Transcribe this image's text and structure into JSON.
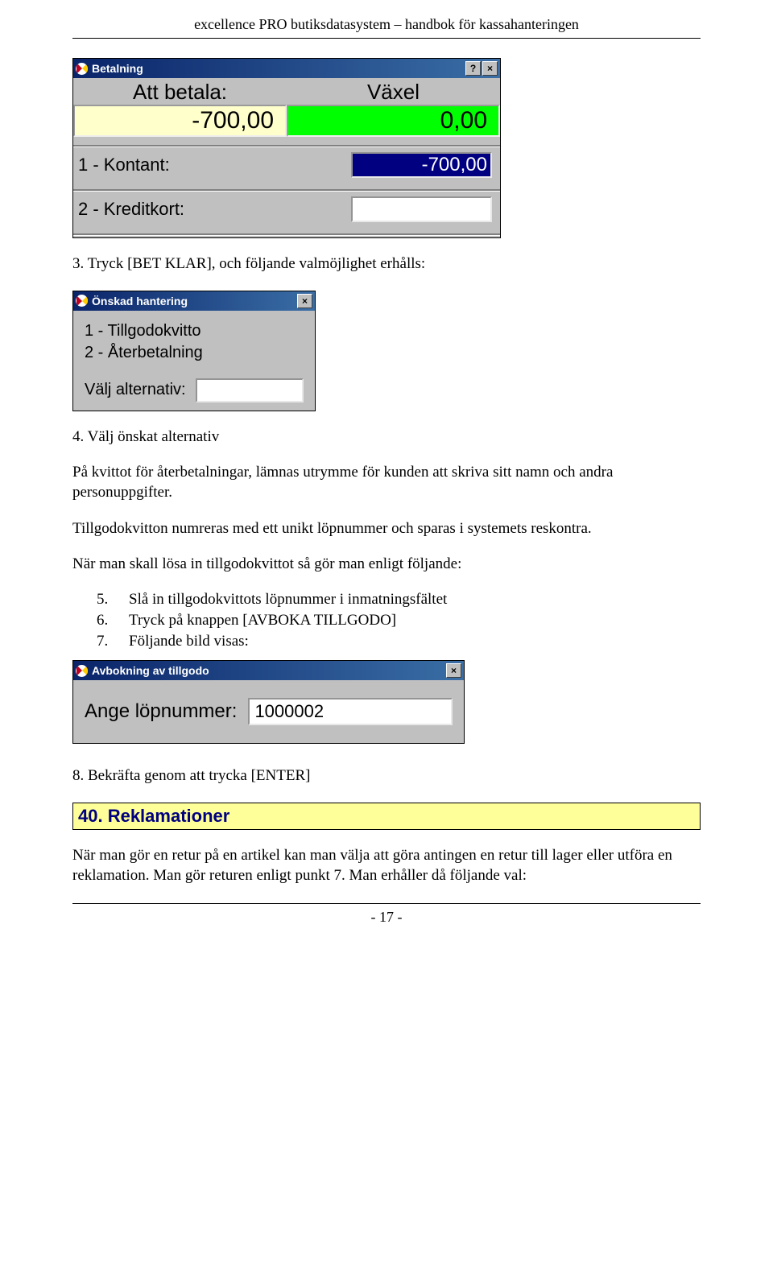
{
  "header": "excellence PRO butiksdatasystem – handbok för kassahanteringen",
  "footer": "- 17 -",
  "betalning": {
    "title": "Betalning",
    "att_betala_label": "Att betala:",
    "att_betala_value": "-700,00",
    "vaxel_label": "Växel",
    "vaxel_value": "0,00",
    "row1_label": "1 - Kontant:",
    "row1_value": "-700,00",
    "row2_label": "2 - Kreditkort:",
    "row2_value": ""
  },
  "step3": "3.   Tryck [BET KLAR], och följande valmöjlighet erhålls:",
  "onskad": {
    "title": "Önskad hantering",
    "opt1": "1 - Tillgodokvitto",
    "opt2": "2 - Återbetalning",
    "prompt": "Välj alternativ:"
  },
  "step4": "4.   Välj önskat alternativ",
  "para1": "På kvittot för återbetalningar, lämnas utrymme för kunden att skriva sitt namn och andra personuppgifter.",
  "para2": "Tillgodokvitton numreras med ett unikt löpnummer och sparas i systemets reskontra.",
  "para3": "När man skall lösa in tillgodokvittot så gör man enligt följande:",
  "list": {
    "i5": "Slå in tillgodokvittots löpnummer i inmatningsfältet",
    "i6": "Tryck på knappen [AVBOKA TILLGODO]",
    "i7": "Följande bild visas:"
  },
  "avbok": {
    "title": "Avbokning av  tillgodo",
    "label": "Ange löpnummer:",
    "value": "1000002"
  },
  "step8": "8.   Bekräfta genom att trycka [ENTER]",
  "section40": "40. Reklamationer",
  "para4": "När man gör en retur på en artikel kan man välja att göra antingen en retur till lager eller utföra en reklamation. Man gör returen enligt punkt 7. Man erhåller då följande val:"
}
